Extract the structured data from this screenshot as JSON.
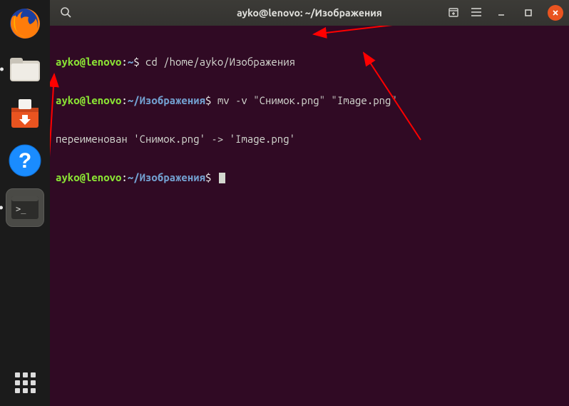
{
  "titlebar": {
    "title": "ayko@lenovo: ~/Изображения"
  },
  "dock": {
    "items": [
      {
        "name": "firefox"
      },
      {
        "name": "files"
      },
      {
        "name": "software"
      },
      {
        "name": "help"
      },
      {
        "name": "terminal"
      }
    ]
  },
  "terminal": {
    "lines": [
      {
        "user": "ayko@lenovo",
        "colon": ":",
        "path": "~",
        "dollar": "$ ",
        "cmd": "cd /home/ayko/Изображения"
      },
      {
        "user": "ayko@lenovo",
        "colon": ":",
        "path": "~/Изображения",
        "dollar": "$ ",
        "cmd": "mv -v \"Снимок.png\" \"Image.png\""
      },
      {
        "output": "переименован 'Снимок.png' -> 'Image.png'"
      },
      {
        "user": "ayko@lenovo",
        "colon": ":",
        "path": "~/Изображения",
        "dollar": "$ ",
        "cmd": "",
        "cursor": true
      }
    ]
  },
  "colors": {
    "accent": "#e95420",
    "terminal_bg": "#300a24",
    "user": "#8ae234",
    "path": "#729fcf",
    "arrow": "#ff0000"
  }
}
